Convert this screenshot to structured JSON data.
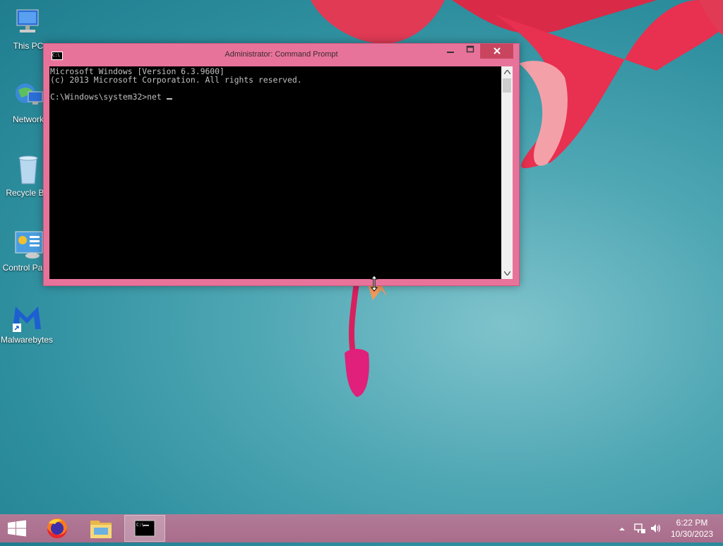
{
  "desktop": {
    "icons": [
      {
        "label": "This PC"
      },
      {
        "label": "Network"
      },
      {
        "label": "Recycle Bin"
      },
      {
        "label": "Control Panel"
      },
      {
        "label": "Malwarebytes"
      }
    ]
  },
  "window": {
    "title": "Administrator: Command Prompt",
    "icon_text": "C:\\",
    "minimize_icon": "minimize-icon",
    "maximize_icon": "maximize-icon",
    "close_icon": "close-icon",
    "console_lines": [
      "Microsoft Windows [Version 6.3.9600]",
      "(c) 2013 Microsoft Corporation. All rights reserved.",
      "",
      "C:\\Windows\\system32>net "
    ]
  },
  "taskbar": {
    "apps": [
      "start-icon",
      "firefox-icon",
      "file-explorer-icon",
      "command-prompt-icon"
    ],
    "tray": {
      "time": "6:22 PM",
      "date": "10/30/2023"
    }
  },
  "colors": {
    "window_frame": "#e8739a",
    "close_button": "#c9455f",
    "taskbar": "#b27a96"
  }
}
